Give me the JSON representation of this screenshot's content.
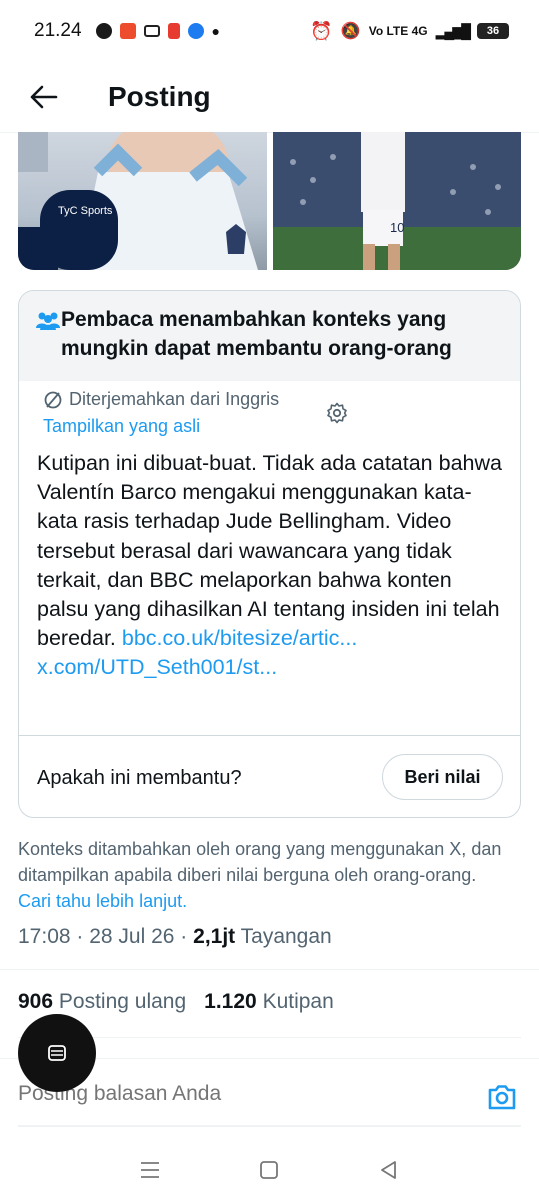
{
  "status_bar": {
    "time": "21.24",
    "network": "Vo LTE 4G",
    "battery": "36"
  },
  "header": {
    "title": "Posting"
  },
  "community_note": {
    "title": "Pembaca menambahkan konteks yang mungkin dapat membantu orang-orang",
    "translated_label": "Diterjemahkan dari Inggris",
    "show_original": "Tampilkan yang asli",
    "body": "Kutipan ini dibuat-buat. Tidak ada catatan bahwa Valentín Barco mengakui menggunakan kata-kata rasis terhadap Jude Bellingham. Video tersebut berasal dari wawancara yang tidak terkait, dan BBC melaporkan bahwa konten palsu yang dihasilkan AI tentang insiden ini telah beredar.",
    "link1": "bbc.co.uk/bitesize/artic...",
    "link2": "x.com/UTD_Seth001/st...",
    "helpful_question": "Apakah ini membantu?",
    "rate_button": "Beri nilai"
  },
  "context_info": {
    "text": "Konteks ditambahkan oleh orang yang menggunakan X, dan ditampilkan apabila diberi nilai berguna oleh orang-orang.",
    "learn_more": "Cari tahu lebih lanjut."
  },
  "post_meta": {
    "time": "17:08",
    "date": "28 Jul 26",
    "views": "2,1jt",
    "views_label": "Tayangan"
  },
  "stats": {
    "reposts": "906",
    "reposts_label": "Posting ulang",
    "quotes": "1.120",
    "quotes_label": "Kutipan"
  },
  "reply": {
    "placeholder": "Posting balasan Anda"
  },
  "colors": {
    "accent": "#1d9bf0",
    "text": "#0f1419",
    "secondary": "#536471"
  }
}
